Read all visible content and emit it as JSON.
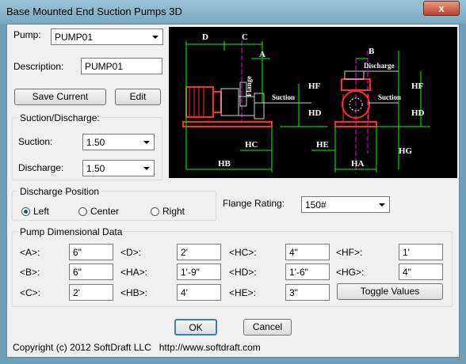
{
  "window": {
    "title": "Base Mounted End Suction Pumps 3D",
    "close_glyph": "x"
  },
  "pump": {
    "label": "Pump:",
    "value": "PUMP01"
  },
  "description": {
    "label": "Description:",
    "value": "PUMP01"
  },
  "buttons": {
    "save_current": "Save Current",
    "edit": "Edit",
    "ok": "OK",
    "cancel": "Cancel",
    "toggle_values": "Toggle Values"
  },
  "suction_discharge": {
    "title": "Suction/Discharge:",
    "suction_label": "Suction:",
    "suction_value": "1.50",
    "discharge_label": "Discharge:",
    "discharge_value": "1.50"
  },
  "discharge_position": {
    "title": "Discharge Position",
    "options": [
      "Left",
      "Center",
      "Right"
    ],
    "selected": "Left"
  },
  "flange": {
    "label": "Flange Rating:",
    "value": "150#"
  },
  "dimensions": {
    "title": "Pump Dimensional Data",
    "fields": [
      {
        "label": "<A>:",
        "value": "6\""
      },
      {
        "label": "<B>:",
        "value": "6\""
      },
      {
        "label": "<C>:",
        "value": "2'"
      },
      {
        "label": "<D>:",
        "value": "2'"
      },
      {
        "label": "<HA>:",
        "value": "1'-9\""
      },
      {
        "label": "<HB>:",
        "value": "4'"
      },
      {
        "label": "<HC>:",
        "value": "4\""
      },
      {
        "label": "<HD>:",
        "value": "1'-6\""
      },
      {
        "label": "<HE>:",
        "value": "3\""
      },
      {
        "label": "<HF>:",
        "value": "1'"
      },
      {
        "label": "<HG>:",
        "value": "4\""
      }
    ]
  },
  "diagram": {
    "labels": {
      "d": "D",
      "c": "C",
      "a": "A",
      "b": "B",
      "flange": "Flange",
      "suction_left": "Suction",
      "suction_right": "Suction",
      "discharge": "Discharge",
      "hf_left": "HF",
      "hd_left": "HD",
      "hf_right": "HF",
      "hd_right": "HD",
      "hc": "HC",
      "he": "HE",
      "hg": "HG",
      "hb": "HB",
      "ha": "HA"
    },
    "colors": {
      "bg": "#000000",
      "dim": "#00ff00",
      "pump": "#ff2a2a",
      "center": "#ff00ff",
      "text": "#ffffff",
      "line": "#cfcfcf"
    }
  },
  "footer": {
    "copyright": "Copyright (c) 2012 SoftDraft LLC   http://www.softdraft.com"
  }
}
